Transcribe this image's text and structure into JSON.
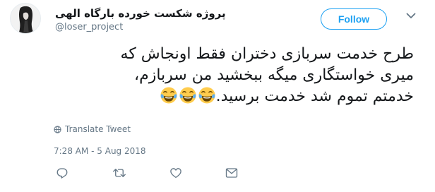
{
  "user": {
    "display_name": "پروژه شکست خورده بارگاه الهی",
    "handle": "@loser_project"
  },
  "follow_button": {
    "label": "Follow"
  },
  "tweet": {
    "lines": [
      "طرح خدمت سربازی دختران فقط اونجاش که",
      "میری خواستگاری میگه ببخشید من سربازم،",
      "خدمتم تموم شد خدمت برسید."
    ],
    "emoji_count": 3
  },
  "translate_label": "Translate Tweet",
  "timestamp": "7:28 AM - 5 Aug 2018",
  "icons": {
    "caret": "chevron-down-icon",
    "translate": "globe-icon",
    "reply": "reply-icon",
    "retweet": "retweet-icon",
    "like": "heart-icon",
    "message": "envelope-icon"
  },
  "colors": {
    "accent": "#1da1f2",
    "secondary_text": "#657786",
    "primary_text": "#14171a"
  }
}
